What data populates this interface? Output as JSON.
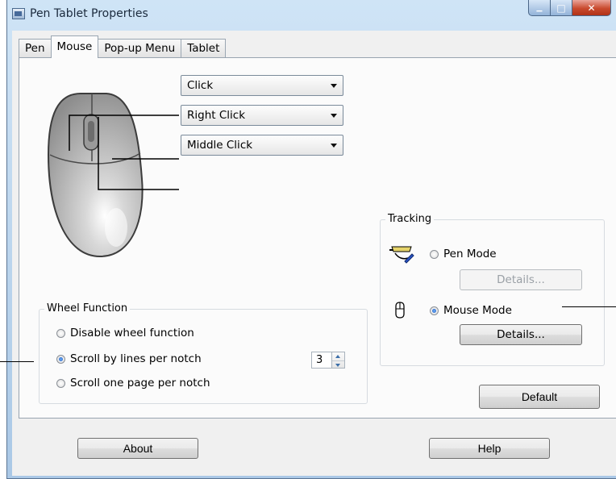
{
  "window": {
    "title": "Pen Tablet Properties",
    "min_glyph": "▁",
    "max_glyph": "□",
    "close_glyph": "✕"
  },
  "tabs": [
    {
      "label": "Pen",
      "active": false
    },
    {
      "label": "Mouse",
      "active": true
    },
    {
      "label": "Pop-up Menu",
      "active": false
    },
    {
      "label": "Tablet",
      "active": false
    }
  ],
  "buttons_mapping": {
    "left": "Click",
    "right": "Right Click",
    "middle": "Middle Click"
  },
  "wheel_function": {
    "title": "Wheel Function",
    "options": [
      {
        "label": "Disable wheel function",
        "selected": false
      },
      {
        "label": "Scroll by lines per notch",
        "selected": true
      },
      {
        "label": "Scroll one page per notch",
        "selected": false
      }
    ],
    "lines_value": "3"
  },
  "tracking": {
    "title": "Tracking",
    "pen_mode": {
      "label": "Pen Mode",
      "selected": false,
      "details_label": "Details...",
      "details_enabled": false
    },
    "mouse_mode": {
      "label": "Mouse Mode",
      "selected": true,
      "details_label": "Details...",
      "details_enabled": true
    }
  },
  "default_label": "Default",
  "about_label": "About",
  "help_label": "Help",
  "icons": [
    "app-icon",
    "mouse-illustration",
    "pen-icon",
    "mouse-icon"
  ],
  "colors": {
    "titlebar": "#b9d3ec",
    "close_button": "#c94a2e",
    "radio_selected": "#1d56b8"
  }
}
